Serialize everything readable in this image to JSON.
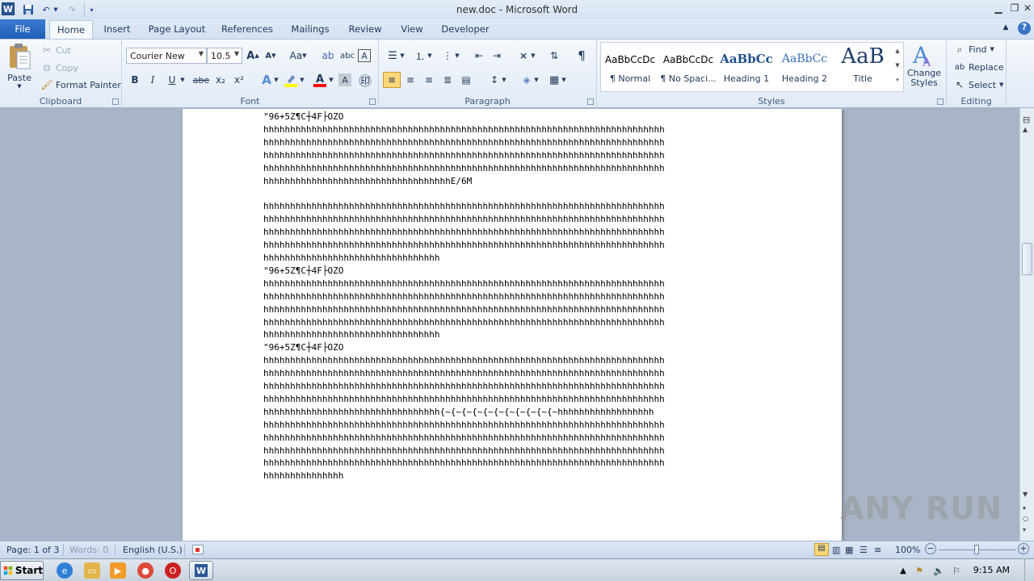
{
  "window": {
    "title": "new.doc - Microsoft Word",
    "logo": "W"
  },
  "qat": {
    "save_icon": "save-icon",
    "undo_icon": "undo-icon",
    "redo_icon": "redo-icon"
  },
  "tabs": [
    "File",
    "Home",
    "Insert",
    "Page Layout",
    "References",
    "Mailings",
    "Review",
    "View",
    "Developer"
  ],
  "clipboard": {
    "paste": "Paste",
    "cut": "Cut",
    "copy": "Copy",
    "format_painter": "Format Painter",
    "label": "Clipboard"
  },
  "font": {
    "name": "Courier New",
    "size": "10.5",
    "label": "Font",
    "bold": "B",
    "italic": "I",
    "underline": "U",
    "strike": "abe",
    "sub": "x₂",
    "sup": "x²",
    "grow": "A",
    "shrink": "A",
    "case": "Aa",
    "highlight_color": "#ffff00",
    "font_color": "#ff0000"
  },
  "paragraph": {
    "label": "Paragraph",
    "pilcrow": "¶"
  },
  "styles": {
    "label": "Styles",
    "items": [
      {
        "sample": "AaBbCcDc",
        "name": "¶ Normal"
      },
      {
        "sample": "AaBbCcDc",
        "name": "¶ No Spaci..."
      },
      {
        "sample": "AaBbCc",
        "name": "Heading 1"
      },
      {
        "sample": "AaBbCc",
        "name": "Heading 2"
      },
      {
        "sample": "AaB",
        "name": "Title"
      }
    ],
    "change_styles": "Change Styles"
  },
  "editing": {
    "label": "Editing",
    "find": "Find",
    "replace": "Replace",
    "select": "Select"
  },
  "document": {
    "lines": [
      "\"96+5Z¶C┼4F├OZO",
      "hhhhhhhhhhhhhhhhhhhhhhhhhhhhhhhhhhhhhhhhhhhhhhhhhhhhhhhhhhhhhhhhhhhhhhhhhhh",
      "hhhhhhhhhhhhhhhhhhhhhhhhhhhhhhhhhhhhhhhhhhhhhhhhhhhhhhhhhhhhhhhhhhhhhhhhhhh",
      "hhhhhhhhhhhhhhhhhhhhhhhhhhhhhhhhhhhhhhhhhhhhhhhhhhhhhhhhhhhhhhhhhhhhhhhhhhh",
      "hhhhhhhhhhhhhhhhhhhhhhhhhhhhhhhhhhhhhhhhhhhhhhhhhhhhhhhhhhhhhhhhhhhhhhhhhhh",
      "hhhhhhhhhhhhhhhhhhhhhhhhhhhhhhhhhhhE/6M",
      "",
      "hhhhhhhhhhhhhhhhhhhhhhhhhhhhhhhhhhhhhhhhhhhhhhhhhhhhhhhhhhhhhhhhhhhhhhhhhhh",
      "hhhhhhhhhhhhhhhhhhhhhhhhhhhhhhhhhhhhhhhhhhhhhhhhhhhhhhhhhhhhhhhhhhhhhhhhhhh",
      "hhhhhhhhhhhhhhhhhhhhhhhhhhhhhhhhhhhhhhhhhhhhhhhhhhhhhhhhhhhhhhhhhhhhhhhhhhh",
      "hhhhhhhhhhhhhhhhhhhhhhhhhhhhhhhhhhhhhhhhhhhhhhhhhhhhhhhhhhhhhhhhhhhhhhhhhhh",
      "hhhhhhhhhhhhhhhhhhhhhhhhhhhhhhhhh",
      "\"96+5Z¶C┼4F├OZO",
      "hhhhhhhhhhhhhhhhhhhhhhhhhhhhhhhhhhhhhhhhhhhhhhhhhhhhhhhhhhhhhhhhhhhhhhhhhhh",
      "hhhhhhhhhhhhhhhhhhhhhhhhhhhhhhhhhhhhhhhhhhhhhhhhhhhhhhhhhhhhhhhhhhhhhhhhhhh",
      "hhhhhhhhhhhhhhhhhhhhhhhhhhhhhhhhhhhhhhhhhhhhhhhhhhhhhhhhhhhhhhhhhhhhhhhhhhh",
      "hhhhhhhhhhhhhhhhhhhhhhhhhhhhhhhhhhhhhhhhhhhhhhhhhhhhhhhhhhhhhhhhhhhhhhhhhhh",
      "hhhhhhhhhhhhhhhhhhhhhhhhhhhhhhhhh",
      "\"96+5Z¶C┼4F├OZO",
      "hhhhhhhhhhhhhhhhhhhhhhhhhhhhhhhhhhhhhhhhhhhhhhhhhhhhhhhhhhhhhhhhhhhhhhhhhhh",
      "hhhhhhhhhhhhhhhhhhhhhhhhhhhhhhhhhhhhhhhhhhhhhhhhhhhhhhhhhhhhhhhhhhhhhhhhhhh",
      "hhhhhhhhhhhhhhhhhhhhhhhhhhhhhhhhhhhhhhhhhhhhhhhhhhhhhhhhhhhhhhhhhhhhhhhhhhh",
      "hhhhhhhhhhhhhhhhhhhhhhhhhhhhhhhhhhhhhhhhhhhhhhhhhhhhhhhhhhhhhhhhhhhhhhhhhhh",
      "hhhhhhhhhhhhhhhhhhhhhhhhhhhhhhhhh{~{~{~{~{~{~{~{~{~{~{~hhhhhhhhhhhhhhhhhh",
      "hhhhhhhhhhhhhhhhhhhhhhhhhhhhhhhhhhhhhhhhhhhhhhhhhhhhhhhhhhhhhhhhhhhhhhhhhhh",
      "hhhhhhhhhhhhhhhhhhhhhhhhhhhhhhhhhhhhhhhhhhhhhhhhhhhhhhhhhhhhhhhhhhhhhhhhhhh",
      "hhhhhhhhhhhhhhhhhhhhhhhhhhhhhhhhhhhhhhhhhhhhhhhhhhhhhhhhhhhhhhhhhhhhhhhhhhh",
      "hhhhhhhhhhhhhhhhhhhhhhhhhhhhhhhhhhhhhhhhhhhhhhhhhhhhhhhhhhhhhhhhhhhhhhhhhhh",
      "hhhhhhhhhhhhhhh"
    ]
  },
  "status": {
    "page": "Page: 1 of 3",
    "words": "Words: 0",
    "language": "English (U.S.)",
    "zoom": "100%"
  },
  "taskbar": {
    "start": "Start",
    "time": "9:15 AM"
  },
  "watermark": "ANY RUN"
}
